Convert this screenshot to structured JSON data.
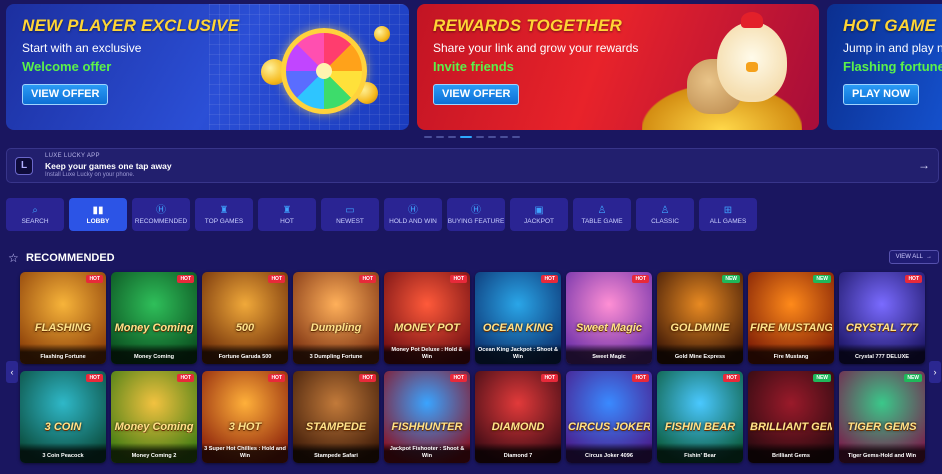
{
  "banners": [
    {
      "title": "NEW PLAYER EXCLUSIVE",
      "subtitle": "Start with an exclusive",
      "accent": "Welcome offer",
      "cta": "VIEW OFFER"
    },
    {
      "title": "REWARDS TOGETHER",
      "subtitle": "Share your link and grow your rewards",
      "accent": "Invite friends",
      "cta": "VIEW OFFER"
    },
    {
      "title": "HOT GAME",
      "subtitle": "Jump in and play no",
      "accent": "Flashing fortune",
      "cta": "PLAY NOW"
    }
  ],
  "app_bar": {
    "logo_glyph": "L",
    "tag": "LUXE LUCKY APP",
    "title": "Keep your games one tap away",
    "subtitle": "Install Luxe Lucky on your phone.",
    "arrow": "→"
  },
  "categories": [
    {
      "label": "SEARCH",
      "icon": "⌕",
      "icon_name": "search-icon"
    },
    {
      "label": "LOBBY",
      "icon": "▮▮",
      "icon_name": "lobby-icon"
    },
    {
      "label": "RECOMMENDED",
      "icon": "Ⓗ",
      "icon_name": "recommended-icon"
    },
    {
      "label": "TOP GAMES",
      "icon": "♜",
      "icon_name": "top-games-icon"
    },
    {
      "label": "HOT",
      "icon": "♜",
      "icon_name": "hot-icon"
    },
    {
      "label": "NEWEST",
      "icon": "▭",
      "icon_name": "newest-icon"
    },
    {
      "label": "HOLD AND WIN",
      "icon": "Ⓗ",
      "icon_name": "hold-and-win-icon"
    },
    {
      "label": "BUYING FEATURE",
      "icon": "Ⓗ",
      "icon_name": "buying-feature-icon"
    },
    {
      "label": "JACKPOT",
      "icon": "▣",
      "icon_name": "jackpot-icon"
    },
    {
      "label": "TABLE GAME",
      "icon": "♙",
      "icon_name": "table-game-icon"
    },
    {
      "label": "CLASSIC",
      "icon": "♙",
      "icon_name": "classic-icon"
    },
    {
      "label": "ALL GAMES",
      "icon": "⊞",
      "icon_name": "all-games-icon"
    }
  ],
  "recommended": {
    "icon": "☆",
    "title": "RECOMMENDED",
    "view_all": "VIEW ALL",
    "view_all_arrow": "→",
    "nav_prev": "‹",
    "nav_next": "›"
  },
  "games": [
    {
      "logo": "FLASHING",
      "name": "Flashing Fortune",
      "badge": "HOT",
      "c1": "#f7b43a",
      "c2": "#8a3d08"
    },
    {
      "logo": "Money Coming",
      "name": "Money Coming",
      "badge": "HOT",
      "c1": "#2fbf5a",
      "c2": "#0a4d1e"
    },
    {
      "logo": "500",
      "name": "Fortune Garuda 500",
      "badge": "HOT",
      "c1": "#f0a93a",
      "c2": "#6b2a07"
    },
    {
      "logo": "Dumpling",
      "name": "3 Dumpling Fortune",
      "badge": "HOT",
      "c1": "#ffb05a",
      "c2": "#7a2f10"
    },
    {
      "logo": "MONEY POT",
      "name": "Money Pot Deluxe : Hold & Win",
      "badge": "HOT",
      "c1": "#ff5a3a",
      "c2": "#6e0d12"
    },
    {
      "logo": "OCEAN KING",
      "name": "Ocean King Jackpot : Shoot & Win",
      "badge": "HOT",
      "c1": "#2aa6e8",
      "c2": "#0b2f6e"
    },
    {
      "logo": "Sweet Magic",
      "name": "Sweet Magic",
      "badge": "HOT",
      "c1": "#ff8fd4",
      "c2": "#6a2ea8"
    },
    {
      "logo": "GOLDMINE",
      "name": "Gold Mine Express",
      "badge": "NEW",
      "c1": "#e88a22",
      "c2": "#3b1606"
    },
    {
      "logo": "FIRE MUSTANG",
      "name": "Fire Mustang",
      "badge": "NEW",
      "c1": "#ff8a1a",
      "c2": "#7a1a05"
    },
    {
      "logo": "CRYSTAL 777",
      "name": "Crystal 777 DELUXE",
      "badge": "HOT",
      "c1": "#7a6bff",
      "c2": "#1b1463"
    },
    {
      "logo": "3 COIN",
      "name": "3 Coin Peacock",
      "badge": "HOT",
      "c1": "#2fb8c8",
      "c2": "#0a4a3a"
    },
    {
      "logo": "Money Coming",
      "name": "Money Coming 2",
      "badge": "HOT",
      "c1": "#f2c240",
      "c2": "#3d7a12"
    },
    {
      "logo": "3 HOT",
      "name": "3 Super Hot Chillies : Hold and Win",
      "badge": "HOT",
      "c1": "#ffb03a",
      "c2": "#8a1f0a"
    },
    {
      "logo": "STAMPEDE",
      "name": "Stampede Safari",
      "badge": "HOT",
      "c1": "#c27a3a",
      "c2": "#3d1a08"
    },
    {
      "logo": "FISHHUNTER",
      "name": "Jackpot Fishooter : Shoot & Win",
      "badge": "HOT",
      "c1": "#3aa4ff",
      "c2": "#8a1020"
    },
    {
      "logo": "DIAMOND",
      "name": "Diamond 7",
      "badge": "HOT",
      "c1": "#e23a3a",
      "c2": "#3a0a14"
    },
    {
      "logo": "CIRCUS JOKER",
      "name": "Circus Joker 4096",
      "badge": "HOT",
      "c1": "#3a8aff",
      "c2": "#4a1a8a"
    },
    {
      "logo": "FISHIN BEAR",
      "name": "Fishin' Bear",
      "badge": "HOT",
      "c1": "#4ac8ff",
      "c2": "#0a5a3a"
    },
    {
      "logo": "BRILLIANT GEMS",
      "name": "Brilliant Gems",
      "badge": "NEW",
      "c1": "#9a1a2a",
      "c2": "#2a0a10"
    },
    {
      "logo": "TIGER GEMS",
      "name": "Tiger Gems-Hold and Win",
      "badge": "NEW",
      "c1": "#3ac88a",
      "c2": "#7a1a4a"
    }
  ],
  "carousel_dots": 8,
  "carousel_active": 3
}
